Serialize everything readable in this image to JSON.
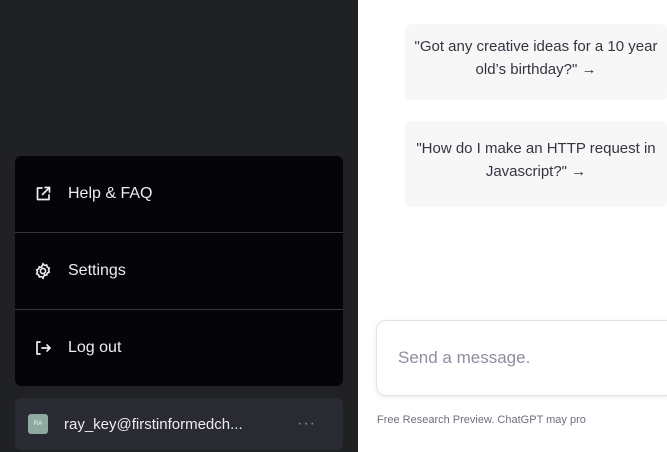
{
  "sidebar": {
    "menu": [
      {
        "label": "Help & FAQ",
        "icon": "external-link-icon"
      },
      {
        "label": "Settings",
        "icon": "gear-icon"
      },
      {
        "label": "Log out",
        "icon": "logout-icon"
      }
    ],
    "user": {
      "avatar_text": "RA",
      "email": "ray_key@firstinformedch...",
      "more": "···"
    }
  },
  "main": {
    "examples": [
      {
        "text": "\"Got any creative ideas for a 10 year old’s birthday?\" →"
      },
      {
        "text": "\"How do I make an HTTP request in Javascript?\" →"
      }
    ],
    "composer": {
      "placeholder": "Send a message."
    },
    "footer": "Free Research Preview. ChatGPT may pro"
  },
  "colors": {
    "sidebar_bg": "#202123",
    "menu_bg": "#050509",
    "example_bg": "#f7f7f8"
  }
}
